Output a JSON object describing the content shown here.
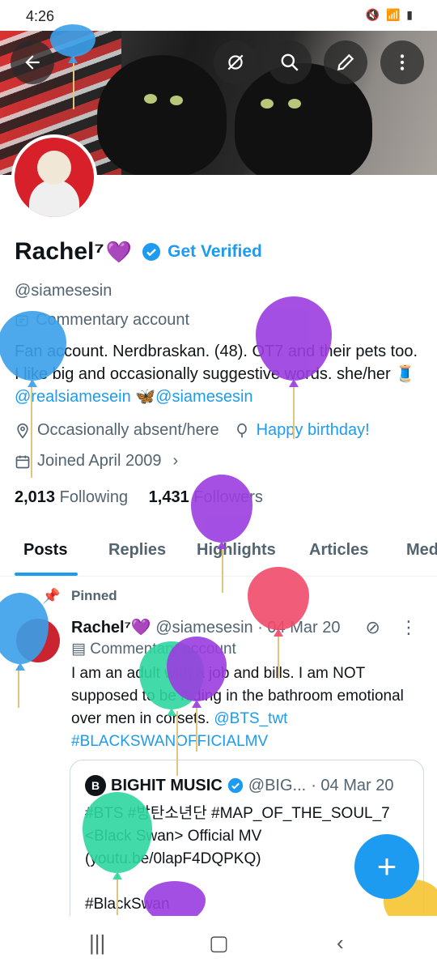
{
  "status_bar": {
    "time": "4:26",
    "icons": "🔇 📶 ▮"
  },
  "banner": {
    "back_label": "←",
    "buttons": [
      "grok-icon",
      "search-icon",
      "edit-icon",
      "more-icon"
    ]
  },
  "profile": {
    "name": "Rachel⁷",
    "emoji": "💜",
    "get_verified": "Get Verified",
    "handle": "@siamesesin",
    "commentary": "Commentary account",
    "bio_text": "Fan account. Nerdbraskan. (48). OT7 and their pets too. I like big and occasionally suggestive words. she/her 🧵",
    "bio_link1": "@realsiamesein",
    "bio_mid": " 🦋",
    "bio_link2": "@siamesesin",
    "location": "Occasionally absent/here",
    "birthday": "Happy birthday!",
    "joined": "Joined April 2009",
    "following_count": "2,013",
    "following_label": "Following",
    "followers_count": "1,431",
    "followers_label": "Followers"
  },
  "tabs": [
    "Posts",
    "Replies",
    "Highlights",
    "Articles",
    "Media"
  ],
  "post": {
    "pinned_label": "Pinned",
    "name": "Rachel⁷💜",
    "handle": "@siamesesin",
    "date": "· 04 Mar 20",
    "label": "Commentary account",
    "text": "I am an adult with a job and bills. I am NOT supposed to be hiding in the bathroom emotional over men in corsets.",
    "link1": "@BTS_twt",
    "link2": "#BLACKSWANOFFICIALMV"
  },
  "quote": {
    "account": "BIGHIT MUSIC",
    "handle": "@BIG...",
    "date": "· 04 Mar 20",
    "text": "#BTS #방탄소년단 #MAP_OF_THE_SOUL_7\n<Black Swan> Official MV\n(youtu.be/0lapF4DQPKQ)\n\n#BlackSwan"
  },
  "fab_label": "+",
  "colors": {
    "accent": "#1d9bf0",
    "muted": "#536471",
    "text": "#0f1419"
  }
}
